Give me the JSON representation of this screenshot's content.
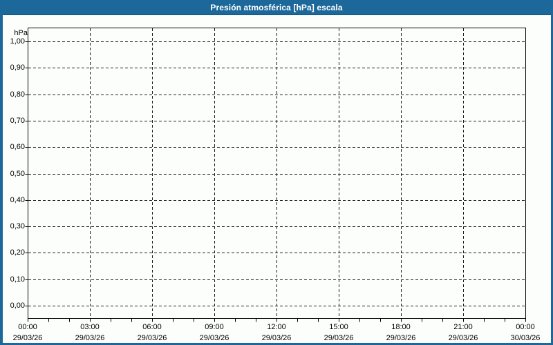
{
  "title_bar": {
    "title": "Presión atmosférica [hPa] escala"
  },
  "colors": {
    "accent": "#1d689a",
    "title_text": "#ffffff",
    "background": "#fcfefc",
    "plot_background": "#fcfefc",
    "grid": "#1a1a1a",
    "frame": "#000000",
    "label_text": "#000000"
  },
  "chart_data": {
    "type": "line",
    "title": "Presión atmosférica [hPa] escala",
    "unit_label": "hPa",
    "ylabel": "hPa",
    "ylim": [
      0.0,
      1.0
    ],
    "y_tick_step": 0.1,
    "y_tick_labels": [
      "1,00",
      "0,90",
      "0,80",
      "0,70",
      "0,60",
      "0,50",
      "0,40",
      "0,30",
      "0,20",
      "0,10",
      "0,00"
    ],
    "x_ticks": [
      {
        "time": "00:00",
        "date": "29/03/26"
      },
      {
        "time": "03:00",
        "date": "29/03/26"
      },
      {
        "time": "06:00",
        "date": "29/03/26"
      },
      {
        "time": "09:00",
        "date": "29/03/26"
      },
      {
        "time": "12:00",
        "date": "29/03/26"
      },
      {
        "time": "15:00",
        "date": "29/03/26"
      },
      {
        "time": "18:00",
        "date": "29/03/26"
      },
      {
        "time": "21:00",
        "date": "29/03/26"
      },
      {
        "time": "00:00",
        "date": "30/03/26"
      }
    ],
    "x_minor_ticks_per_major": 3,
    "grid": "dashed",
    "legend": "none",
    "series": []
  }
}
